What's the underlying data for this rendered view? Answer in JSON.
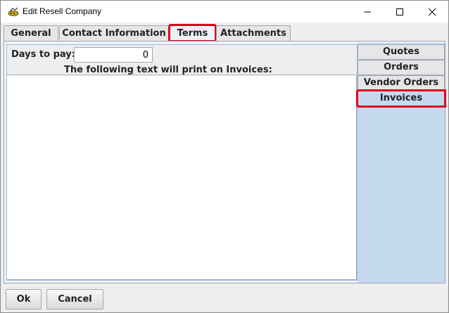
{
  "window": {
    "title": "Edit Resell Company"
  },
  "tabs": [
    "General",
    "Contact Information",
    "Terms",
    "Attachments"
  ],
  "terms": {
    "days_label": "Days to pay:",
    "days_value": "0",
    "invoice_text_label": "The following text will print on Invoices:",
    "invoice_text": ""
  },
  "side_tabs": [
    "Quotes",
    "Orders",
    "Vendor Orders",
    "Invoices"
  ],
  "buttons": {
    "ok": "Ok",
    "cancel": "Cancel"
  },
  "colors": {
    "highlight": "#e0001b",
    "side_panel": "#c5d9ef"
  }
}
